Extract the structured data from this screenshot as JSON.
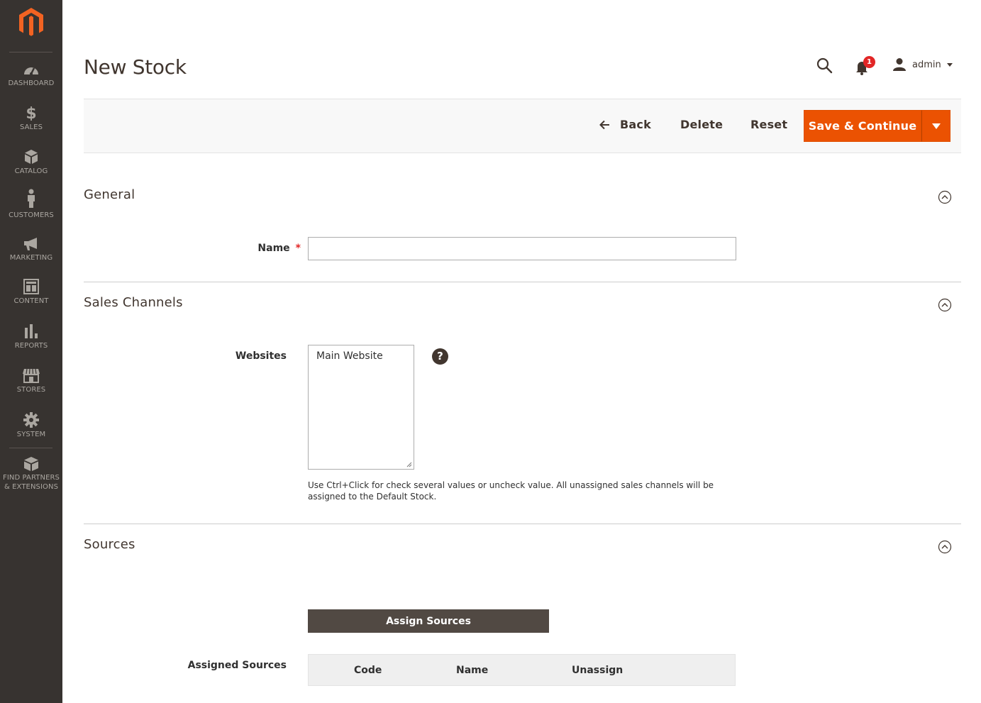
{
  "sidebar": {
    "items": [
      {
        "key": "dashboard",
        "label": "DASHBOARD",
        "icon": "speedometer-icon"
      },
      {
        "key": "sales",
        "label": "SALES",
        "icon": "dollar-icon"
      },
      {
        "key": "catalog",
        "label": "CATALOG",
        "icon": "box-icon"
      },
      {
        "key": "customers",
        "label": "CUSTOMERS",
        "icon": "person-icon"
      },
      {
        "key": "marketing",
        "label": "MARKETING",
        "icon": "megaphone-icon"
      },
      {
        "key": "content",
        "label": "CONTENT",
        "icon": "layout-icon"
      },
      {
        "key": "reports",
        "label": "REPORTS",
        "icon": "bar-chart-icon"
      },
      {
        "key": "stores",
        "label": "STORES",
        "icon": "storefront-icon"
      },
      {
        "key": "system",
        "label": "SYSTEM",
        "icon": "gear-icon"
      },
      {
        "key": "partners",
        "label_line1": "FIND PARTNERS",
        "label_line2": "& EXTENSIONS",
        "icon": "cube-icon"
      }
    ]
  },
  "header": {
    "title": "New Stock",
    "notifications_count": "1",
    "user_name": "admin"
  },
  "actions": {
    "back": "Back",
    "delete": "Delete",
    "reset": "Reset",
    "save_continue": "Save & Continue"
  },
  "general": {
    "title": "General",
    "name_label": "Name",
    "required_mark": "*",
    "name_value": ""
  },
  "sales_channels": {
    "title": "Sales Channels",
    "websites_label": "Websites",
    "websites_options": [
      "Main Website"
    ],
    "help_mark": "?",
    "note": "Use Ctrl+Click for check several values or uncheck value. All unassigned sales channels will be assigned to the Default Stock."
  },
  "sources": {
    "title": "Sources",
    "assign_button": "Assign Sources",
    "assigned_label": "Assigned Sources",
    "columns": [
      "Code",
      "Name",
      "Unassign"
    ]
  },
  "colors": {
    "sidebar_bg": "#373330",
    "accent": "#eb5202",
    "dark_button": "#514943"
  }
}
